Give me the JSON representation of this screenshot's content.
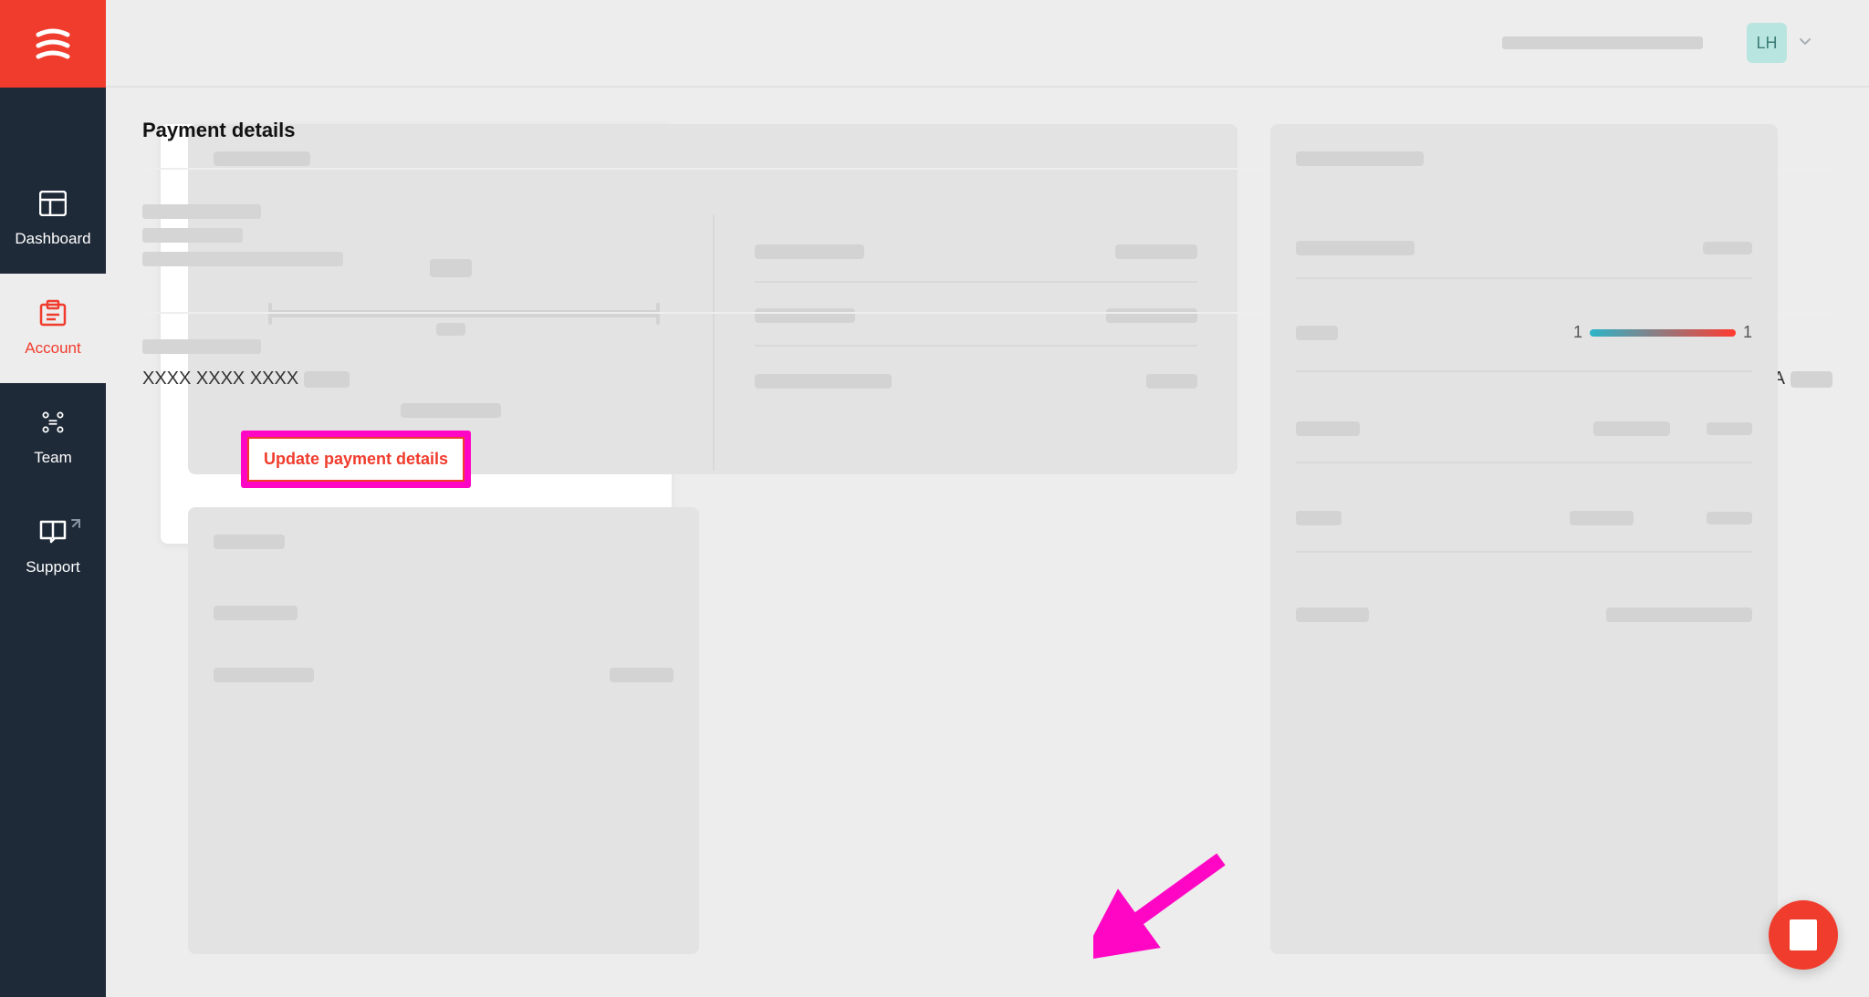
{
  "sidebar": {
    "items": [
      {
        "label": "Dashboard"
      },
      {
        "label": "Account"
      },
      {
        "label": "Team"
      },
      {
        "label": "Support"
      }
    ]
  },
  "header": {
    "avatar_initials": "LH"
  },
  "payment": {
    "title": "Payment details",
    "masked_card": "XXXX XXXX XXXX",
    "card_brand": "VISA",
    "update_button": "Update payment details"
  },
  "right": {
    "gauge_left": "1",
    "gauge_right": "1"
  }
}
